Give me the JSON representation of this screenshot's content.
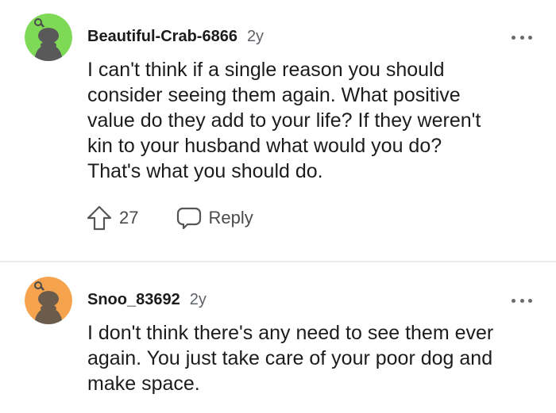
{
  "comments": [
    {
      "username": "Beautiful-Crab-6866",
      "age": "2y",
      "avatar_color": "#7ed957",
      "avatar_icon": "snoo-avatar-icon",
      "body": "I can't think if a single reason you should\nconsider seeing them again. What positive\nvalue do they add to your life? If they weren't\nkin to your husband what would you do?\nThat's what you should do.",
      "upvotes": "27",
      "reply_label": "Reply"
    },
    {
      "username": "Snoo_83692",
      "age": "2y",
      "avatar_color": "#f5a44d",
      "avatar_icon": "snoo-avatar-icon",
      "body": "I don't think there's any need to see them ever\nagain. You just take care of your poor dog and\nmake space."
    }
  ],
  "icons": {
    "upvote": "upvote-arrow-icon",
    "reply": "speech-bubble-icon",
    "more": "more-options-icon"
  }
}
